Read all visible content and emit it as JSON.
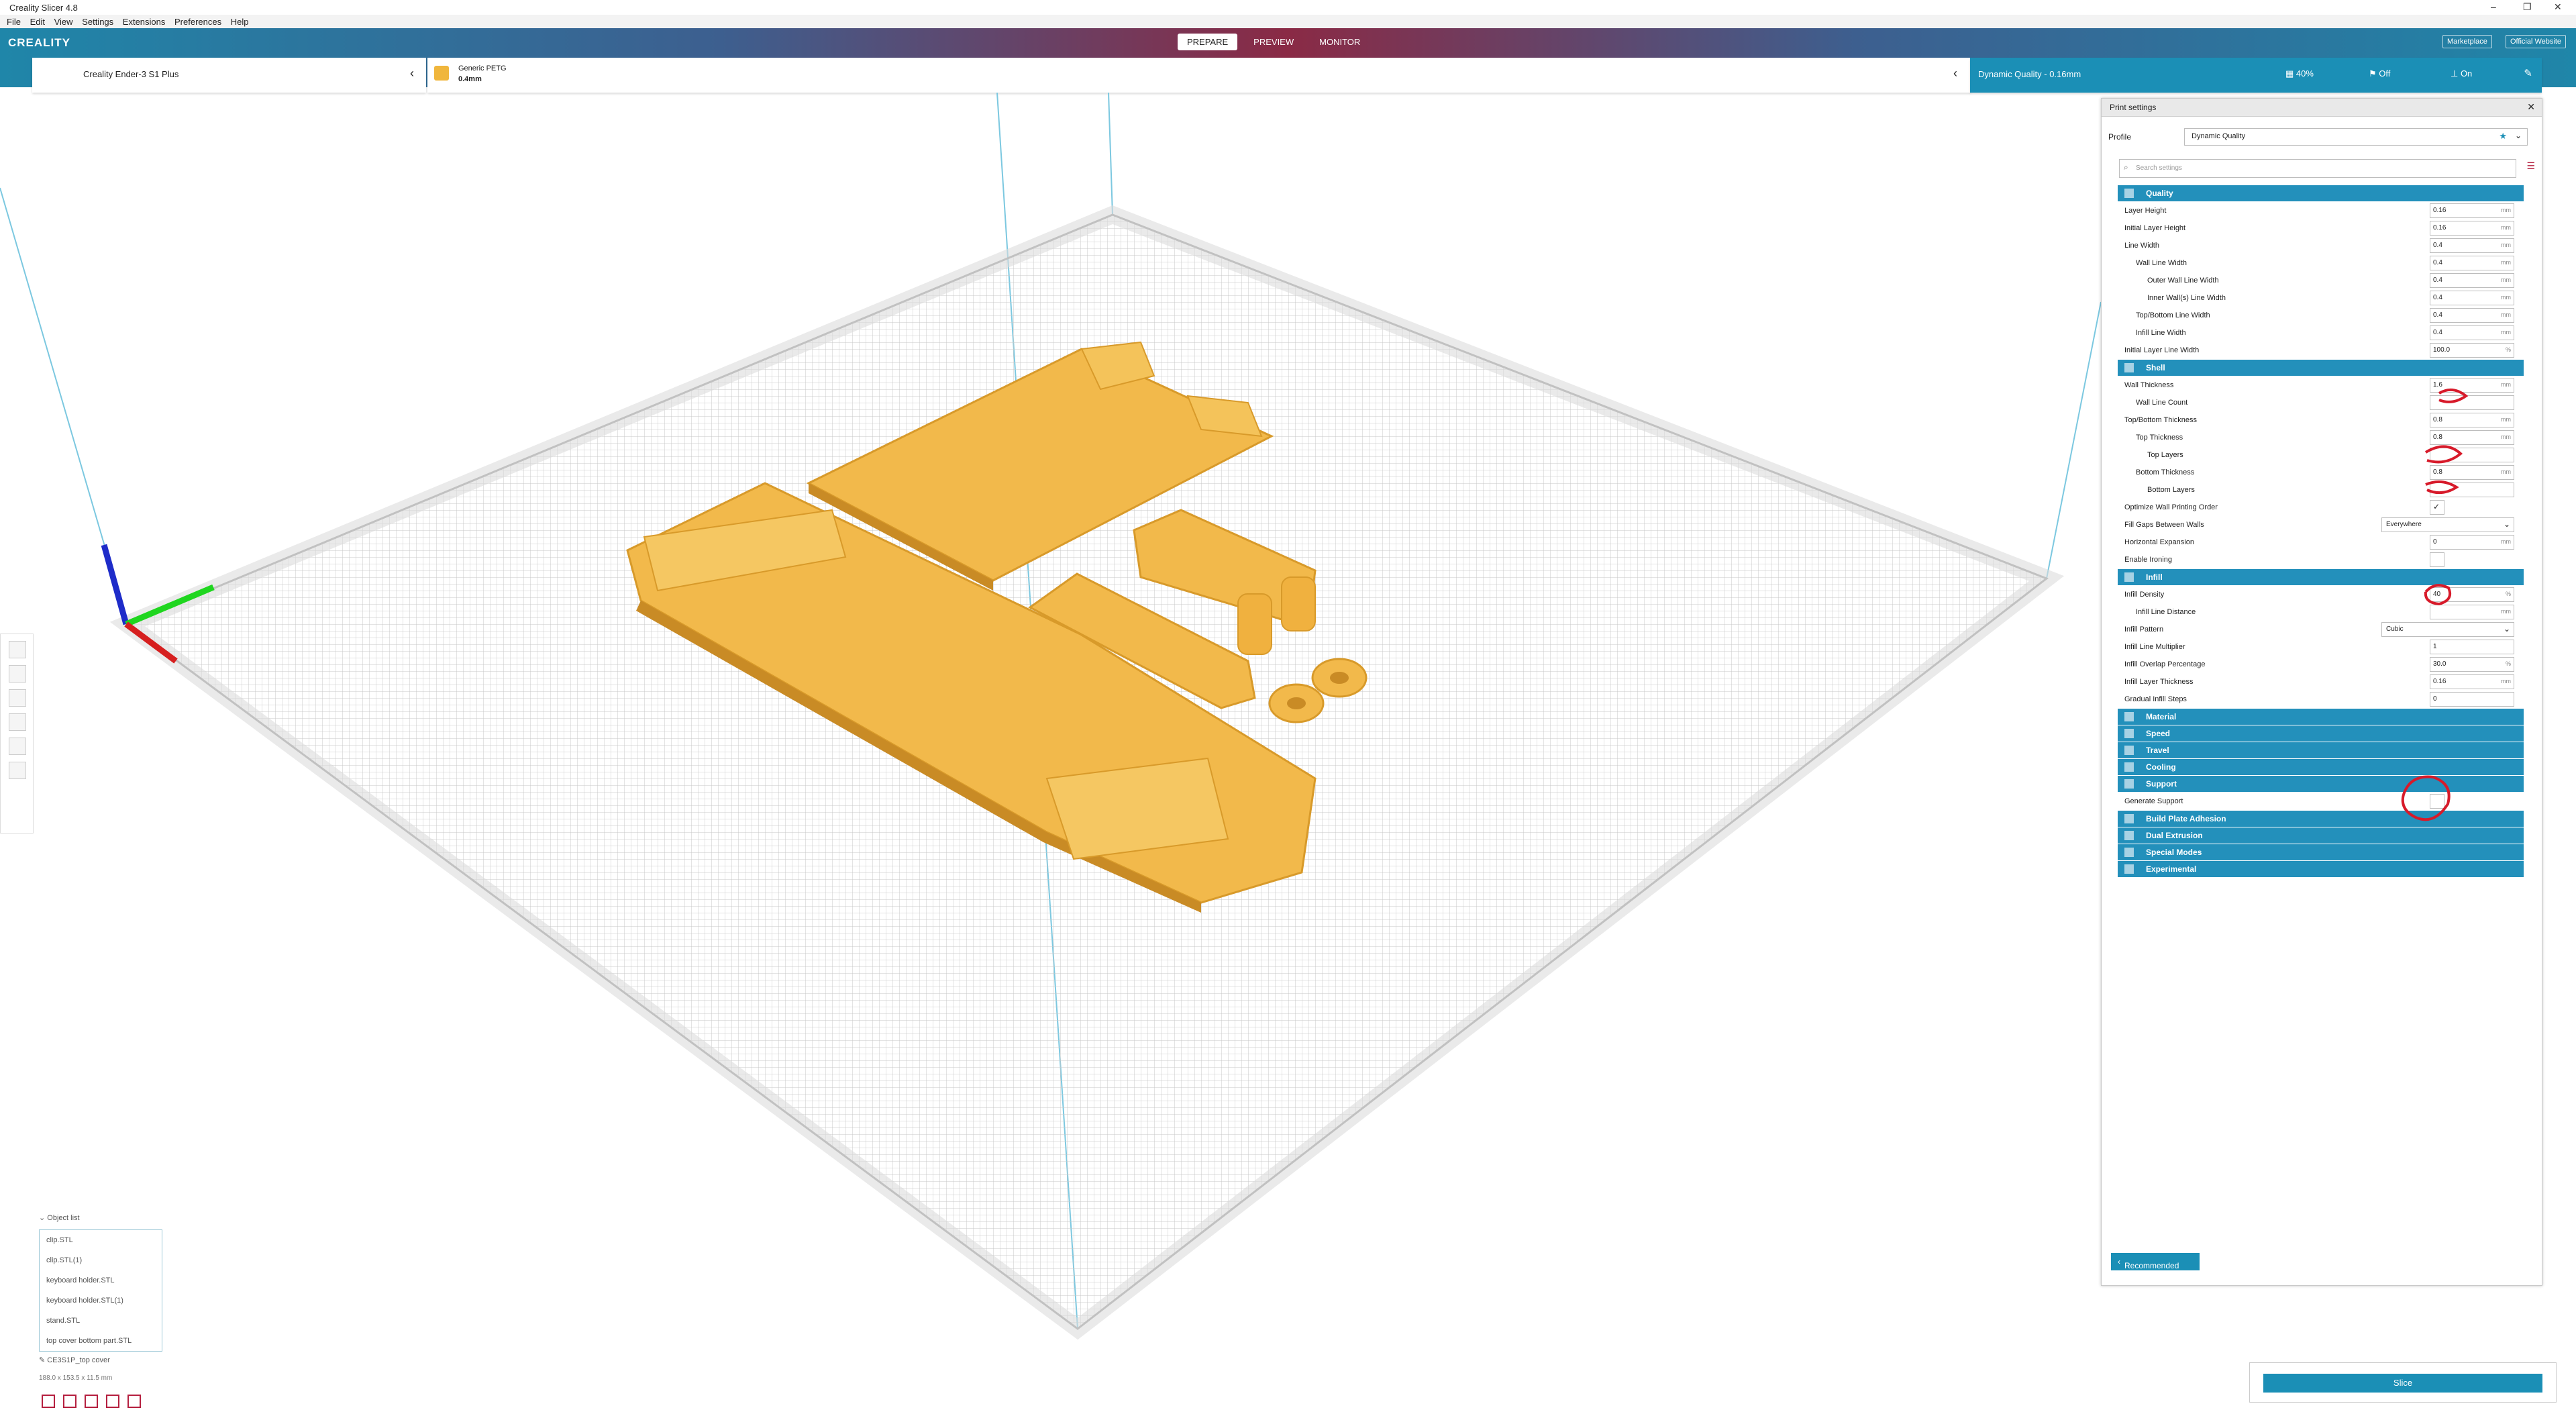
{
  "window": {
    "title": "Creality Slicer 4.8",
    "controls": [
      "–",
      "❐",
      "✕"
    ]
  },
  "menu": [
    "File",
    "Edit",
    "View",
    "Settings",
    "Extensions",
    "Preferences",
    "Help"
  ],
  "header": {
    "logo": "CREALITY",
    "stages": [
      "PREPARE",
      "PREVIEW",
      "MONITOR"
    ],
    "active_stage": "PREPARE",
    "right_buttons": [
      "Marketplace",
      "Official Website"
    ]
  },
  "machine": {
    "name": "Creality Ender-3 S1 Plus"
  },
  "material": {
    "name": "Generic PETG",
    "nozzle": "0.4mm"
  },
  "quality_bar": {
    "profile": "Dynamic Quality - 0.16mm",
    "infill": "40%",
    "support": "Off",
    "adhesion": "On"
  },
  "print_settings": {
    "title": "Print settings",
    "profile_label": "Profile",
    "profile_value": "Dynamic Quality",
    "search_placeholder": "Search settings",
    "categories": [
      {
        "name": "Quality",
        "rows": [
          {
            "label": "Layer Height",
            "indent": 0,
            "value": "0.16",
            "unit": "mm"
          },
          {
            "label": "Initial Layer Height",
            "indent": 0,
            "value": "0.16",
            "unit": "mm"
          },
          {
            "label": "Line Width",
            "indent": 0,
            "value": "0.4",
            "unit": "mm"
          },
          {
            "label": "Wall Line Width",
            "indent": 1,
            "value": "0.4",
            "unit": "mm"
          },
          {
            "label": "Outer Wall Line Width",
            "indent": 2,
            "value": "0.4",
            "unit": "mm"
          },
          {
            "label": "Inner Wall(s) Line Width",
            "indent": 2,
            "value": "0.4",
            "unit": "mm"
          },
          {
            "label": "Top/Bottom Line Width",
            "indent": 1,
            "value": "0.4",
            "unit": "mm"
          },
          {
            "label": "Infill Line Width",
            "indent": 1,
            "value": "0.4",
            "unit": "mm"
          },
          {
            "label": "Initial Layer Line Width",
            "indent": 0,
            "value": "100.0",
            "unit": "%"
          }
        ]
      },
      {
        "name": "Shell",
        "rows": [
          {
            "label": "Wall Thickness",
            "indent": 0,
            "value": "1.6",
            "unit": "mm"
          },
          {
            "label": "Wall Line Count",
            "indent": 1,
            "value": "",
            "unit": ""
          },
          {
            "label": "Top/Bottom Thickness",
            "indent": 0,
            "value": "0.8",
            "unit": "mm"
          },
          {
            "label": "Top Thickness",
            "indent": 1,
            "value": "0.8",
            "unit": "mm"
          },
          {
            "label": "Top Layers",
            "indent": 2,
            "value": "",
            "unit": ""
          },
          {
            "label": "Bottom Thickness",
            "indent": 1,
            "value": "0.8",
            "unit": "mm"
          },
          {
            "label": "Bottom Layers",
            "indent": 2,
            "value": "",
            "unit": ""
          },
          {
            "label": "Optimize Wall Printing Order",
            "indent": 0,
            "type": "check",
            "value": "✓"
          },
          {
            "label": "Fill Gaps Between Walls",
            "indent": 0,
            "type": "select",
            "value": "Everywhere"
          },
          {
            "label": "Horizontal Expansion",
            "indent": 0,
            "value": "0",
            "unit": "mm"
          },
          {
            "label": "Enable Ironing",
            "indent": 0,
            "type": "check",
            "value": ""
          }
        ]
      },
      {
        "name": "Infill",
        "rows": [
          {
            "label": "Infill Density",
            "indent": 0,
            "value": "40",
            "unit": "%"
          },
          {
            "label": "Infill Line Distance",
            "indent": 1,
            "value": "",
            "unit": "mm"
          },
          {
            "label": "Infill Pattern",
            "indent": 0,
            "type": "select",
            "value": "Cubic"
          },
          {
            "label": "Infill Line Multiplier",
            "indent": 0,
            "value": "1",
            "unit": ""
          },
          {
            "label": "Infill Overlap Percentage",
            "indent": 0,
            "value": "30.0",
            "unit": "%"
          },
          {
            "label": "Infill Layer Thickness",
            "indent": 0,
            "value": "0.16",
            "unit": "mm"
          },
          {
            "label": "Gradual Infill Steps",
            "indent": 0,
            "value": "0",
            "unit": ""
          }
        ]
      },
      {
        "name": "Material",
        "rows": []
      },
      {
        "name": "Speed",
        "rows": []
      },
      {
        "name": "Travel",
        "rows": []
      },
      {
        "name": "Cooling",
        "rows": []
      },
      {
        "name": "Support",
        "rows": [
          {
            "label": "Generate Support",
            "indent": 0,
            "type": "check",
            "value": ""
          }
        ]
      },
      {
        "name": "Build Plate Adhesion",
        "rows": []
      },
      {
        "name": "Dual Extrusion",
        "rows": []
      },
      {
        "name": "Special Modes",
        "rows": []
      },
      {
        "name": "Experimental",
        "rows": []
      }
    ],
    "recommended_button": "Recommended"
  },
  "objects": {
    "header": "Object list",
    "items": [
      "clip.STL",
      "clip.STL(1)",
      "keyboard holder.STL",
      "keyboard holder.STL(1)",
      "stand.STL",
      "top cover bottom part.STL"
    ],
    "selected_name": "CE3S1P_top cover",
    "dimensions": "188.0 x 153.5 x 11.5 mm"
  },
  "slice_button": "Slice",
  "colors": {
    "accent": "#1b8fb6",
    "brand_red": "#b51f3f",
    "model": "#f2b94b",
    "annotation": "#d71a2a"
  }
}
